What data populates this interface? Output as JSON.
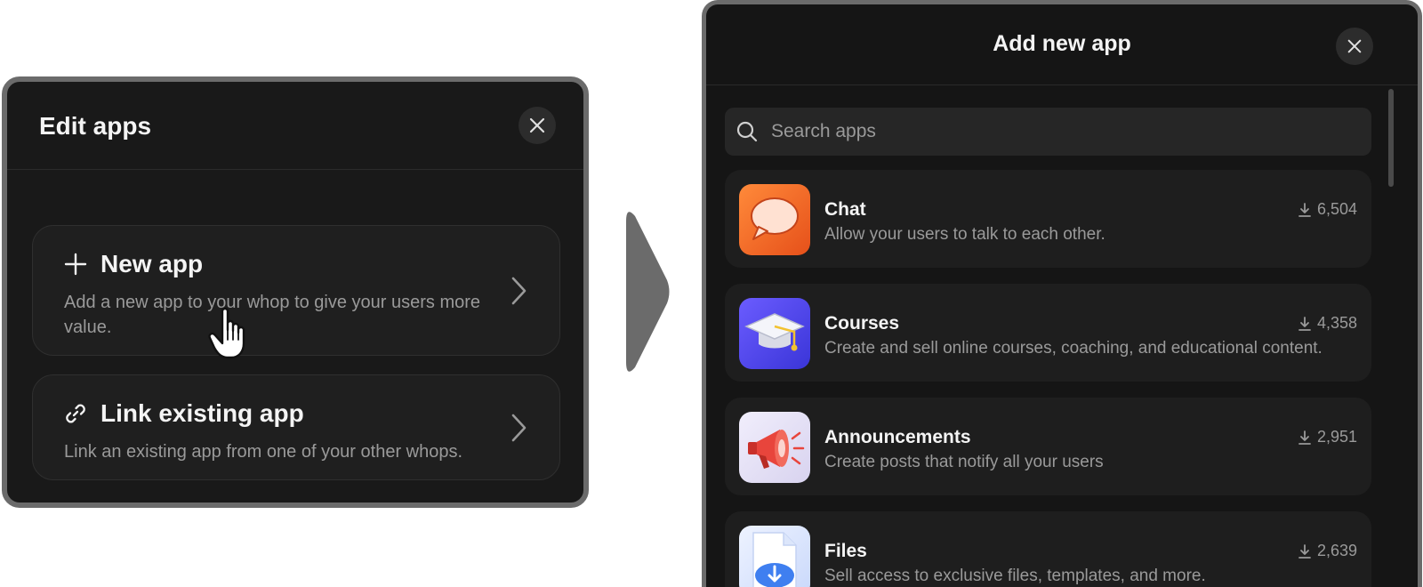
{
  "edit_apps": {
    "title": "Edit apps",
    "options": [
      {
        "title": "New app",
        "description": "Add a new app to your whop to give your users more value."
      },
      {
        "title": "Link existing app",
        "description": "Link an existing app from one of your other whops."
      }
    ]
  },
  "add_new_app": {
    "title": "Add new app",
    "search_placeholder": "Search apps",
    "apps": [
      {
        "name": "Chat",
        "description": "Allow your users to talk to each other.",
        "downloads": "6,504",
        "icon": "chat-bubble-icon"
      },
      {
        "name": "Courses",
        "description": "Create and sell online courses, coaching, and educational content.",
        "downloads": "4,358",
        "icon": "graduation-cap-icon"
      },
      {
        "name": "Announcements",
        "description": "Create posts that notify all your users",
        "downloads": "2,951",
        "icon": "megaphone-icon"
      },
      {
        "name": "Files",
        "description": "Sell access to exclusive files, templates, and more.",
        "downloads": "2,639",
        "icon": "cloud-download-icon"
      }
    ]
  },
  "colors": {
    "panel_bg": "#191919",
    "panel_border": "#6b6b6b",
    "card_bg": "#1e1e1e",
    "text_primary": "#f4f4f4",
    "text_secondary": "#9a9a9a",
    "arrow": "#6b6b6b"
  }
}
